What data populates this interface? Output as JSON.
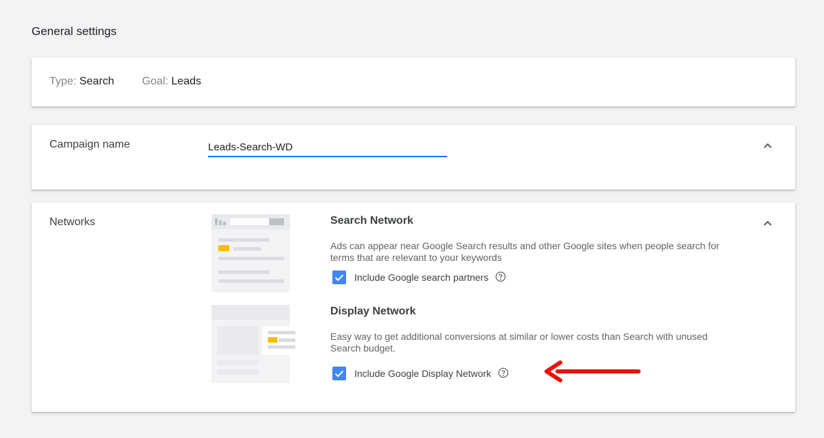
{
  "page": {
    "title": "General settings"
  },
  "type_card": {
    "type_label": "Type:",
    "type_value": "Search",
    "goal_label": "Goal:",
    "goal_value": "Leads"
  },
  "campaign_name": {
    "label": "Campaign name",
    "value": "Leads-Search-WD"
  },
  "networks": {
    "label": "Networks",
    "search": {
      "title": "Search Network",
      "description": "Ads can appear near Google Search results and other Google sites when people search for terms that are relevant to your keywords",
      "checkbox_label": "Include Google search partners",
      "checked": true
    },
    "display": {
      "title": "Display Network",
      "description": "Easy way to get additional conversions at similar or lower costs than Search with unused Search budget.",
      "checkbox_label": "Include Google Display Network",
      "checked": true
    }
  },
  "colors": {
    "accent": "#1a73e8",
    "checkbox": "#4285f4",
    "annotation_arrow": "#e8120c",
    "illustration_highlight": "#fbbc04"
  },
  "icons": {
    "collapse": "chevron-up-icon",
    "help": "help-circle-icon",
    "check": "check-icon"
  }
}
